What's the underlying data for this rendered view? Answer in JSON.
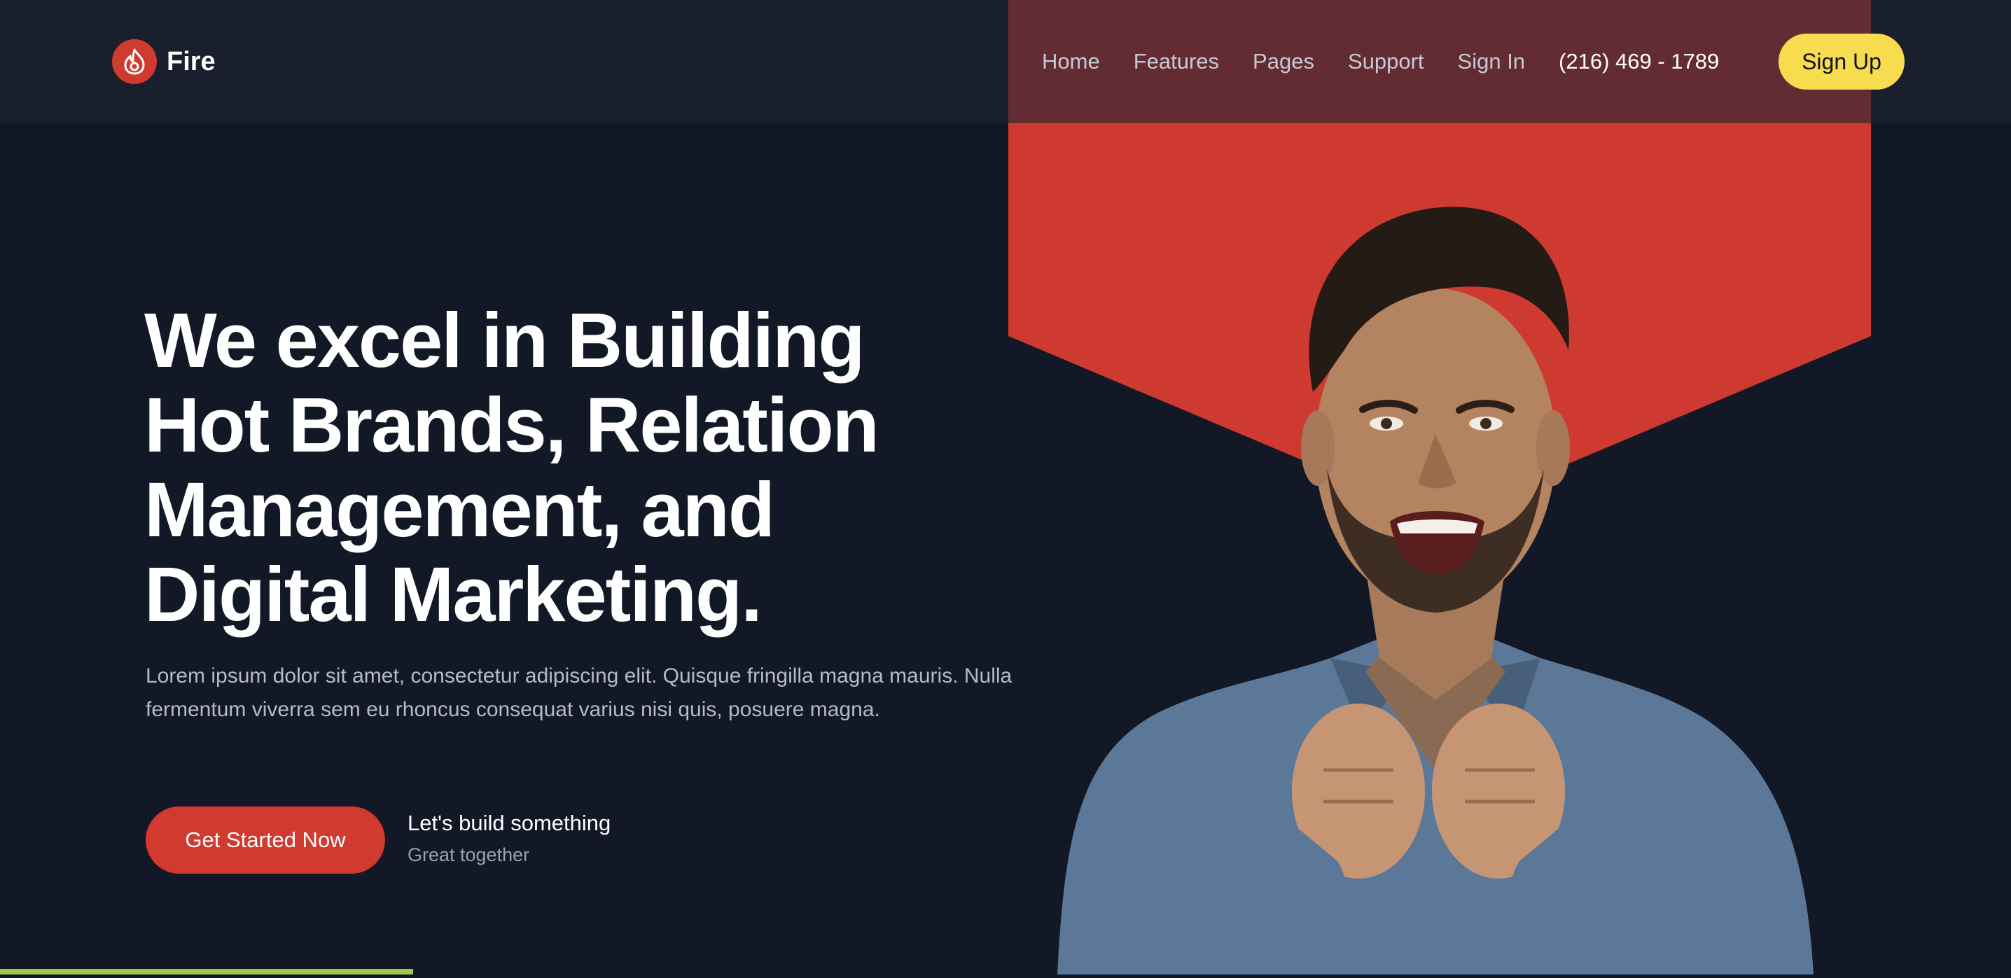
{
  "brand": {
    "name": "Fire",
    "logo_icon": "flame-icon",
    "accent": "#d13a2e"
  },
  "nav": {
    "links": [
      "Home",
      "Features",
      "Pages",
      "Support",
      "Sign In"
    ],
    "phone": "(216) 469 - 1789",
    "signup_label": "Sign Up",
    "signup_color": "#f7dc4f"
  },
  "hero": {
    "title_lines": [
      "We excel in Building",
      "Hot Brands, Relation",
      "Management, and",
      "Digital Marketing."
    ],
    "description": "Lorem ipsum dolor sit amet, consectetur adipiscing elit. Quisque fringilla magna mauris. Nulla fermentum viverra sem eu rhoncus consequat varius nisi quis, posuere magna.",
    "cta_label": "Get Started Now",
    "side_title": "Let's build something",
    "side_subtitle": "Great together"
  },
  "colors": {
    "background": "#131826",
    "panel": "#cf3a30"
  }
}
